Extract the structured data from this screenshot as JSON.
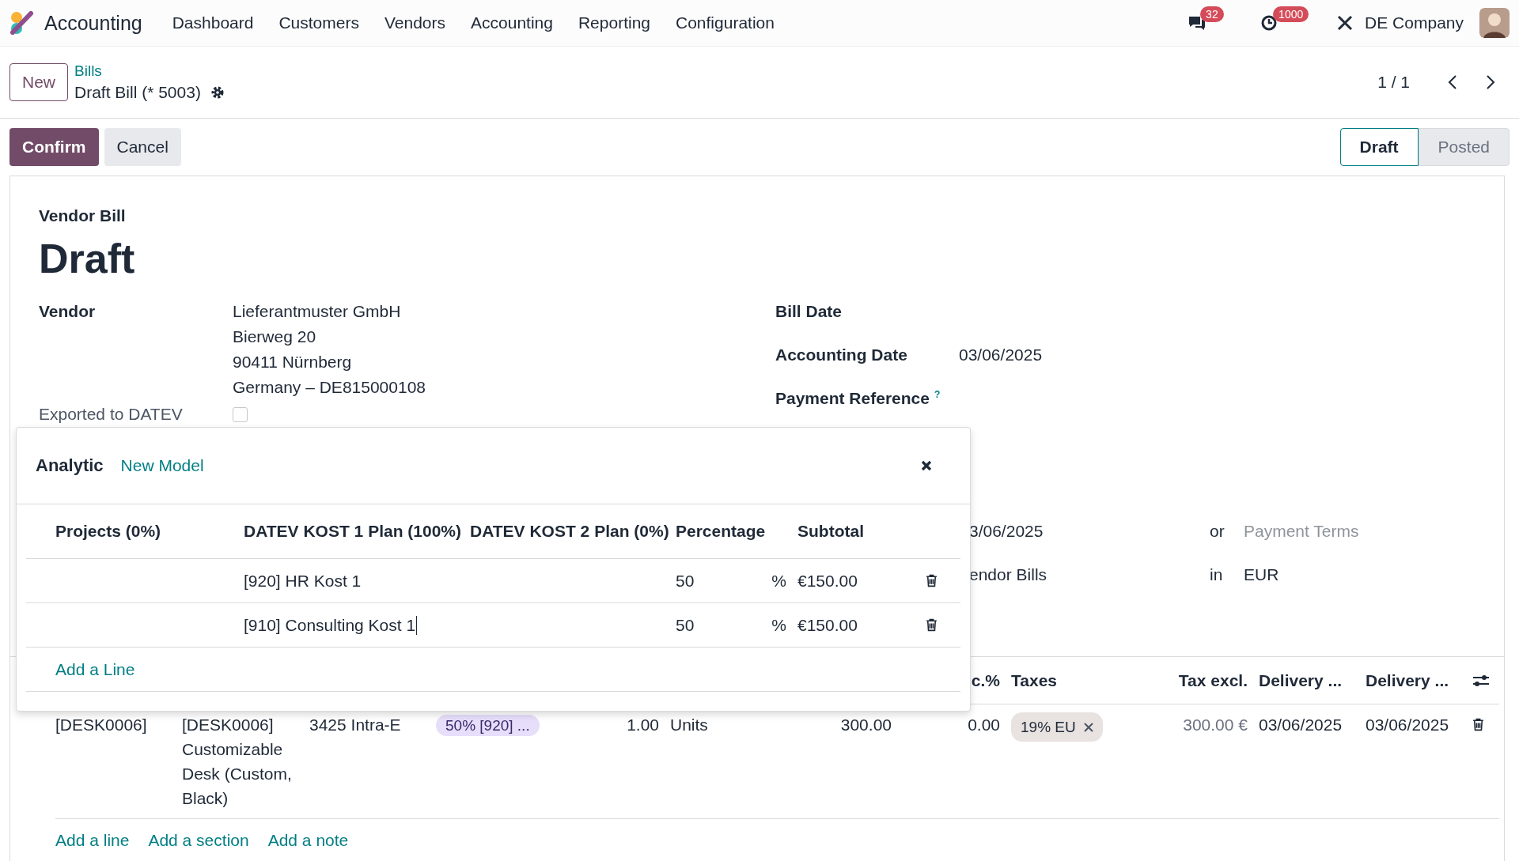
{
  "navbar": {
    "app_name": "Accounting",
    "menu": [
      "Dashboard",
      "Customers",
      "Vendors",
      "Accounting",
      "Reporting",
      "Configuration"
    ],
    "messages_badge": "32",
    "activities_badge": "1000",
    "company": "DE Company"
  },
  "control_panel": {
    "new_button": "New",
    "breadcrumb": "Bills",
    "record_title": "Draft Bill (* 5003)",
    "pager": "1 / 1"
  },
  "actions": [
    {
      "label": "Confirm",
      "kind": "primary"
    },
    {
      "label": "Cancel",
      "kind": "secondary"
    }
  ],
  "stages": [
    {
      "label": "Draft",
      "selected": true
    },
    {
      "label": "Posted",
      "selected": false
    }
  ],
  "form": {
    "subtitle": "Vendor Bill",
    "title": "Draft",
    "vendor_label": "Vendor",
    "vendor_address": [
      "Lieferantmuster GmbH",
      "Bierweg 20",
      "90411 Nürnberg",
      "Germany – DE815000108"
    ],
    "exported_label": "Exported to DATEV",
    "exported_checked": false,
    "right_fields": [
      {
        "label": "Bill Date"
      },
      {
        "label": "Accounting Date",
        "value": "03/06/2025"
      },
      {
        "label": "Payment Reference",
        "help": "?"
      }
    ],
    "partial_fields": [
      {
        "value": "3/06/2025",
        "connector": "or",
        "placeholder": "Payment Terms"
      },
      {
        "value": "endor Bills",
        "connector": "in",
        "extra": "EUR"
      }
    ]
  },
  "lines": {
    "columns": [
      "c.%",
      "Taxes",
      "Tax excl.",
      "Delivery ...",
      "Delivery ..."
    ],
    "rows": [
      {
        "product": "[DESK0006]",
        "label": "[DESK0006] Customizable Desk (Custom, Black)",
        "account": "3425 Intra-E",
        "analytic": "50% [920] ...",
        "quantity": "1.00",
        "uom": "Units",
        "price": "300.00",
        "discount": "0.00",
        "tax": "19% EU",
        "tax_excl": "300.00 €",
        "delivery_1": "03/06/2025",
        "delivery_2": "03/06/2025"
      }
    ],
    "add_links": [
      "Add a line",
      "Add a section",
      "Add a note"
    ]
  },
  "analytic_popup": {
    "title": "Analytic",
    "new_model": "New Model",
    "columns": [
      "Projects (0%)",
      "DATEV KOST 1 Plan (100%)",
      "DATEV KOST 2 Plan (0%)",
      "Percentage",
      "Subtotal"
    ],
    "rows": [
      {
        "kost1": "[920] HR Kost 1",
        "percentage": "50",
        "percent_sign": "%",
        "subtotal": "€150.00",
        "editing": false
      },
      {
        "kost1": "[910] Consulting Kost 1",
        "percentage": "50",
        "percent_sign": "%",
        "subtotal": "€150.00",
        "editing": true
      }
    ],
    "add_line": "Add a Line"
  }
}
